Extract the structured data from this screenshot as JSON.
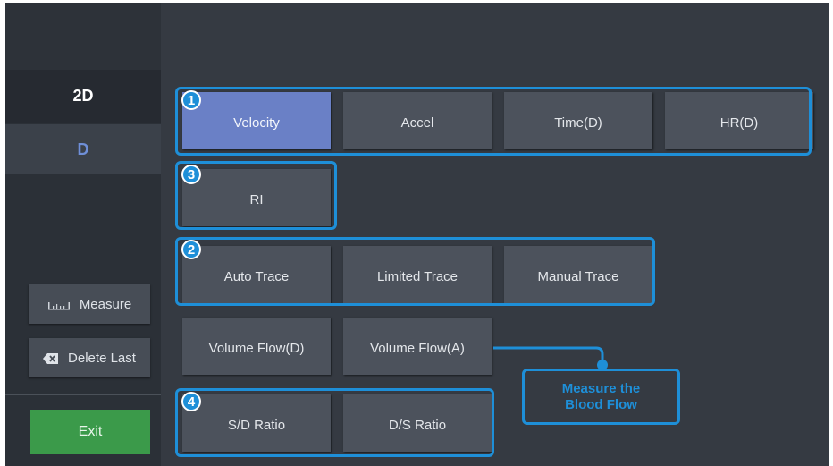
{
  "sidebar": {
    "modes": [
      "2D",
      "D"
    ],
    "measure_label": "Measure",
    "measure_icon": "ruler-icon",
    "delete_label": "Delete Last",
    "delete_icon": "backspace-icon",
    "exit_label": "Exit"
  },
  "buttons": {
    "velocity": "Velocity",
    "accel": "Accel",
    "time_d": "Time(D)",
    "hr_d": "HR(D)",
    "ri": "RI",
    "auto_trace": "Auto Trace",
    "limited_trace": "Limited Trace",
    "manual_trace": "Manual Trace",
    "volume_flow_d": "Volume Flow(D)",
    "volume_flow_a": "Volume Flow(A)",
    "sd_ratio": "S/D Ratio",
    "ds_ratio": "D/S Ratio"
  },
  "annotations": {
    "badge_1": "1",
    "badge_2": "2",
    "badge_3": "3",
    "badge_4": "4",
    "callout_line1": "Measure the",
    "callout_line2": "Blood Flow"
  },
  "colors": {
    "highlight": "#1e8fd8",
    "active_button": "#6a80c6",
    "exit_button": "#3b9a4a",
    "mode_d_text": "#6f8fd8"
  }
}
